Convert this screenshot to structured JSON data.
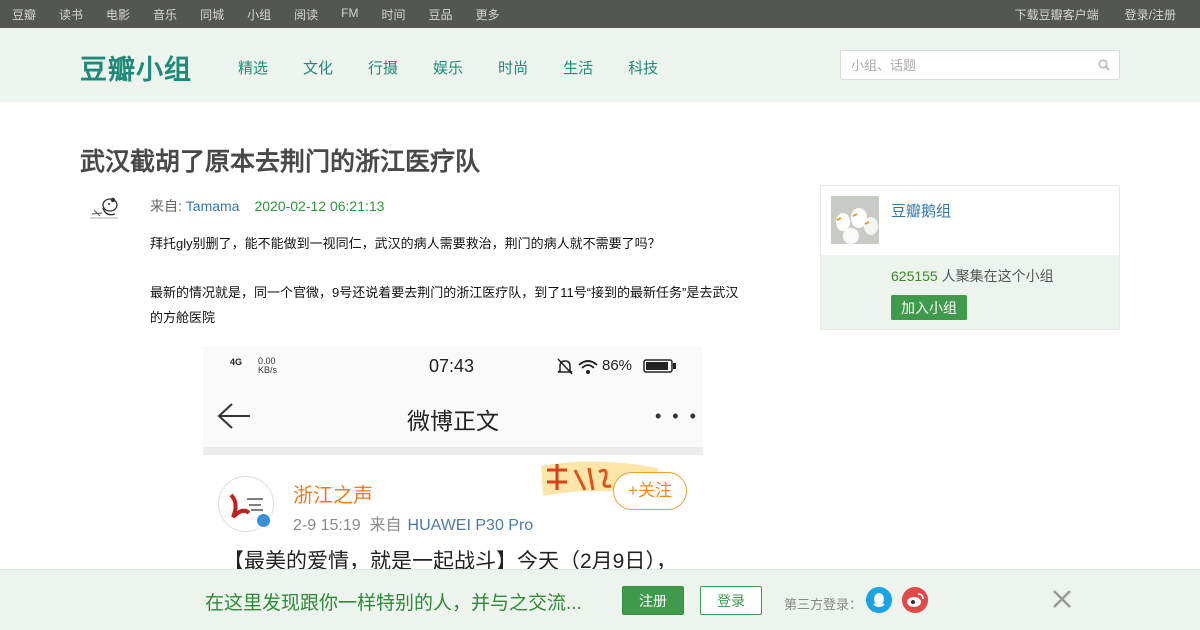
{
  "global_nav": {
    "items": [
      "豆瓣",
      "读书",
      "电影",
      "音乐",
      "同城",
      "小组",
      "阅读",
      "FM",
      "时间",
      "豆品",
      "更多"
    ],
    "download": "下载豆瓣客户端",
    "login": "登录/注册"
  },
  "header": {
    "logo": "豆瓣小组",
    "nav": [
      "精选",
      "文化",
      "行摄",
      "娱乐",
      "时尚",
      "生活",
      "科技"
    ],
    "search_placeholder": "小组、话题"
  },
  "topic": {
    "title": "武汉截胡了原本去荆门的浙江医疗队",
    "from_label": "来自: ",
    "author": "Tamama",
    "time": "2020-02-12 06:21:13",
    "paragraph1": "拜托gly别删了，能不能做到一视同仁，武汉的病人需要救治，荆门的病人就不需要了吗？",
    "paragraph2": "最新的情况就是，同一个官微，9号还说着要去荆门的浙江医疗队，到了11号“接到的最新任务”是去武汉的方舱医院"
  },
  "screenshot": {
    "signal": "4G",
    "speed_value": "0.00",
    "speed_unit": "KB/s",
    "clock": "07:43",
    "battery": "86%",
    "page_title": "微博正文",
    "more": "• • •",
    "account_name": "浙江之声",
    "post_date": "2-9 15:19",
    "source_label": "来自",
    "device": "HUAWEI P30 Pro",
    "follow": "+关注",
    "body_text": "【最美的爱情，就是一起战斗】今天（2月9日），"
  },
  "group": {
    "name": "豆瓣鹅组",
    "member_count": "625155",
    "member_suffix": " 人聚集在这个小组",
    "join": "加入小组"
  },
  "banner": {
    "text": "在这里发现跟你一样特别的人，并与之交流...",
    "register": "注册",
    "login": "登录",
    "third_party": "第三方登录："
  },
  "colors": {
    "accent_green": "#3f9a4b",
    "link_blue": "#3377aa",
    "logo_teal": "#1f8a78",
    "topbar": "#545652",
    "header_bg": "#edf4ed"
  }
}
